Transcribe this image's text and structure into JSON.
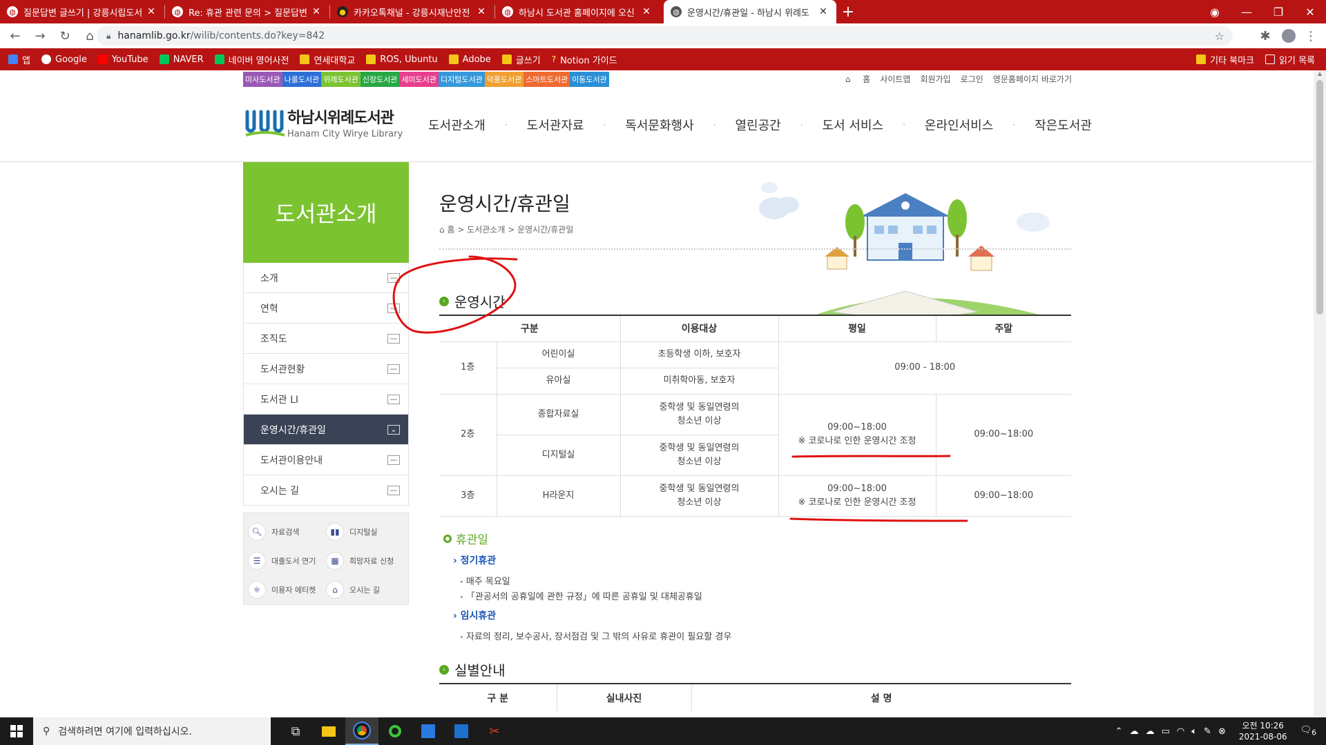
{
  "browser": {
    "tabs": [
      {
        "title": "질문답변 글쓰기 | 강릉시립도서",
        "icon": "globe-icon"
      },
      {
        "title": "Re: 휴관 관련 문의 > 질문답변",
        "icon": "globe-icon"
      },
      {
        "title": "카카오톡채널 - 강릉시재난안전",
        "icon": "kakao-icon"
      },
      {
        "title": "하남시 도서관 홈페이지에 오신",
        "icon": "globe-icon"
      },
      {
        "title": "운영시간/휴관일 - 하남시 위례도",
        "icon": "globe-icon",
        "active": true
      }
    ],
    "url_host": "hanamlib.go.kr",
    "url_path": "/wilib/contents.do?key=842",
    "bookmarks": [
      "앱",
      "Google",
      "YouTube",
      "NAVER",
      "네이버 영어사전",
      "연세대학교",
      "ROS, Ubuntu",
      "Adobe",
      "글쓰기",
      "Notion 가이드"
    ],
    "other_bookmarks": "기타 북마크",
    "reading_list": "읽기 목록",
    "accent": "#b81414"
  },
  "site": {
    "branches": [
      {
        "label": "미사도서관",
        "color": "#9b59b6"
      },
      {
        "label": "나룰도서관",
        "color": "#2d6fd6"
      },
      {
        "label": "위례도서관",
        "color": "#7cc332"
      },
      {
        "label": "신장도서관",
        "color": "#28a745"
      },
      {
        "label": "세미도서관",
        "color": "#e83e8c"
      },
      {
        "label": "디지털도서관",
        "color": "#3498db"
      },
      {
        "label": "덕풍도서관",
        "color": "#f0a030"
      },
      {
        "label": "스마트도서관",
        "color": "#f06a30"
      },
      {
        "label": "이동도서관",
        "color": "#2c8fd6"
      }
    ],
    "util": [
      "홈",
      "사이트맵",
      "회원가입",
      "로그인",
      "영문홈페이지 바로가기"
    ],
    "logo_ko": "하남시위례도서관",
    "logo_en": "Hanam City Wirye Library",
    "gnb": [
      "도서관소개",
      "도서관자료",
      "독서문화행사",
      "열린공간",
      "도서 서비스",
      "온라인서비스",
      "작은도서관"
    ]
  },
  "lnb": {
    "title": "도서관소개",
    "items": [
      "소개",
      "연혁",
      "조직도",
      "도서관현황",
      "도서관 LI",
      "운영시간/휴관일",
      "도서관이용안내",
      "오시는 길"
    ],
    "active_index": 5
  },
  "quick": [
    {
      "label": "자료검색",
      "icon": "search-icon"
    },
    {
      "label": "디지털실",
      "icon": "digital-icon"
    },
    {
      "label": "대출도서 연기",
      "icon": "book-list-icon"
    },
    {
      "label": "희망자료 신청",
      "icon": "calculator-icon"
    },
    {
      "label": "이용자 에티켓",
      "icon": "atom-icon"
    },
    {
      "label": "오시는 길",
      "icon": "house-icon"
    }
  ],
  "content": {
    "title": "운영시간/휴관일",
    "breadcrumb": [
      "홈",
      "도서관소개",
      "운영시간/휴관일"
    ],
    "hours_heading": "운영시간",
    "hours_table": {
      "headers": [
        "구분",
        "이용대상",
        "평일",
        "주말"
      ],
      "floor1": "1층",
      "floor2": "2층",
      "floor3": "3층",
      "r1_room": "어린이실",
      "r1_target": "초등학생 이하, 보호자",
      "r2_room": "유아실",
      "r2_target": "미취학아동, 보호자",
      "f1_hours": "09:00 - 18:00",
      "r3_room": "종합자료실",
      "r3_target_1": "중학생 및 동일연령의",
      "r3_target_2": "청소년 이상",
      "r4_room": "디지털실",
      "r4_target_1": "중학생 및 동일연령의",
      "r4_target_2": "청소년 이상",
      "f2_weekday": "09:00~18:00",
      "f2_note": "※ 코로나로 인한 운영시간 조정",
      "f2_weekend": "09:00~18:00",
      "r5_room": "H라운지",
      "r5_target_1": "중학생 및 동일연령의",
      "r5_target_2": "청소년 이상",
      "f3_weekday": "09:00~18:00",
      "f3_note": "※ 코로나로 인한 운영시간 조정",
      "f3_weekend": "09:00~18:00"
    },
    "holiday_heading": "휴관일",
    "regular_heading": "정기휴관",
    "regular_items": [
      "매주 목요일",
      "「관공서의 공휴일에 관한 규정」에 따른 공휴일 및 대체공휴일"
    ],
    "temp_heading": "임시휴관",
    "temp_items": [
      "자료의 정리, 보수공사, 장서점검 및 그 밖의 사유로 휴관이 필요할 경우"
    ],
    "rooms_heading": "실별안내",
    "rooms_headers": [
      "구 분",
      "실내사진",
      "설 명"
    ]
  },
  "taskbar": {
    "search_placeholder": "검색하려면 여기에 입력하십시오.",
    "time": "오전 10:26",
    "date": "2021-08-06",
    "notifications": "6"
  },
  "annotation_color": "#e01010"
}
